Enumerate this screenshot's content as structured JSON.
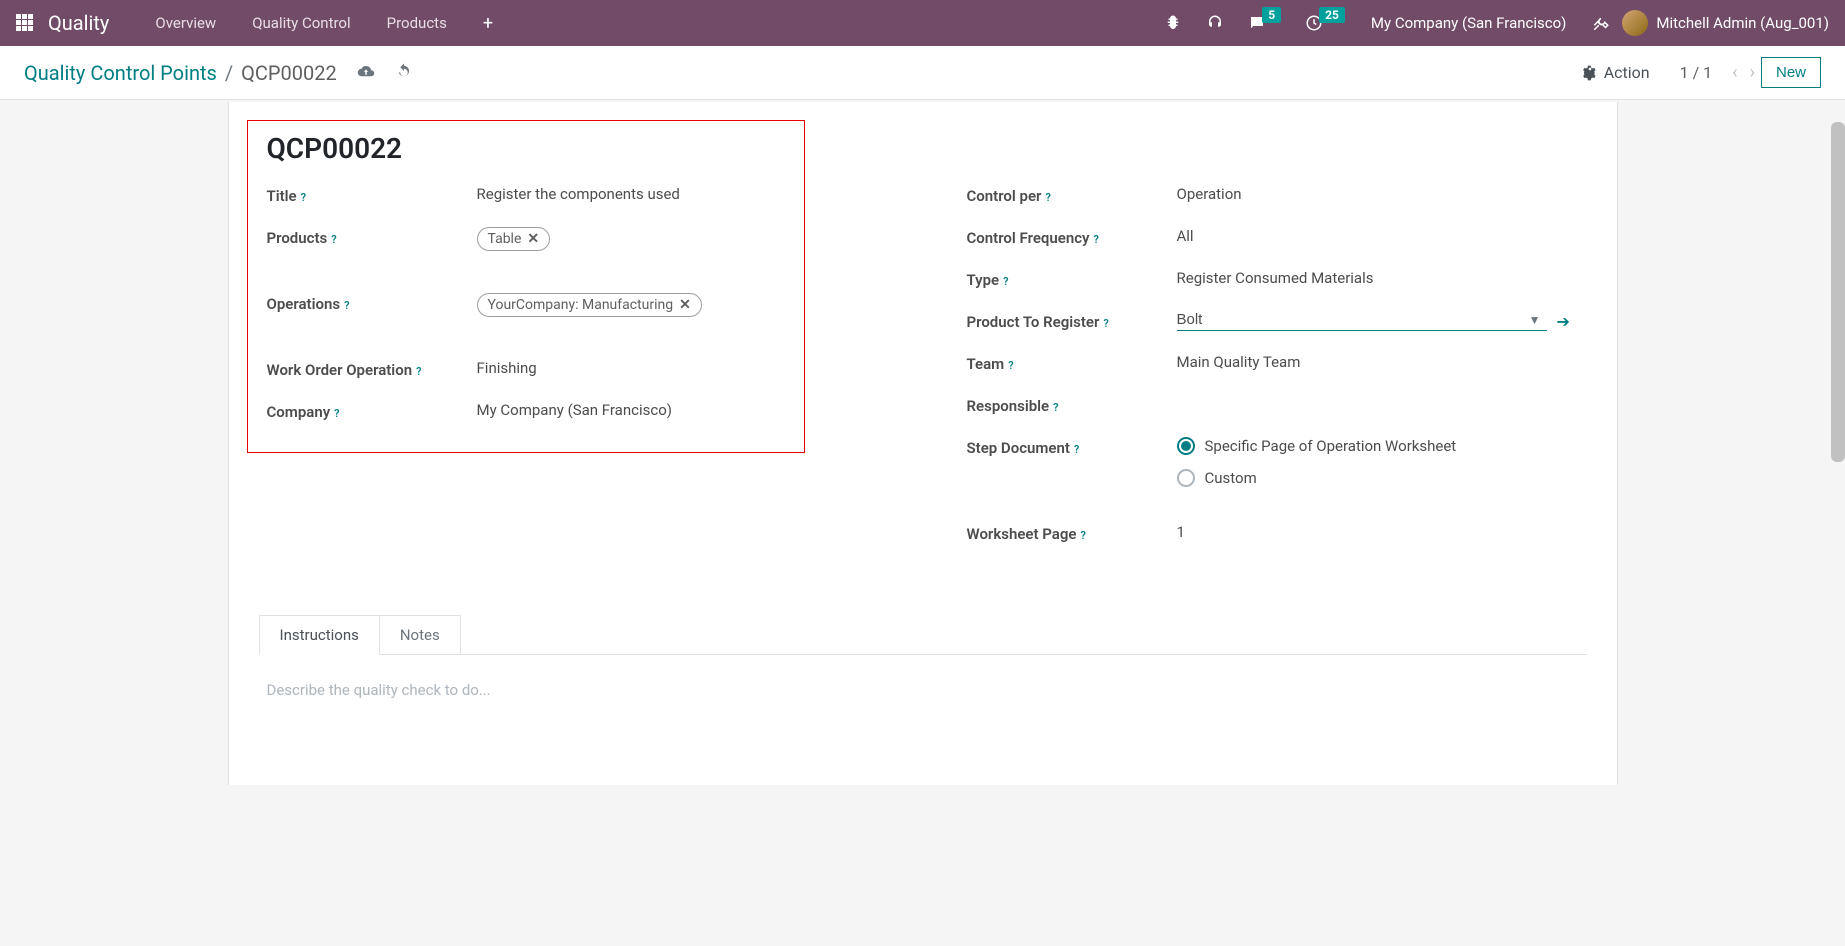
{
  "topbar": {
    "brand": "Quality",
    "nav": [
      "Overview",
      "Quality Control",
      "Products"
    ],
    "msg_badge": "5",
    "activity_badge": "25",
    "company": "My Company (San Francisco)",
    "user": "Mitchell Admin (Aug_001)"
  },
  "controlbar": {
    "breadcrumb_parent": "Quality Control Points",
    "breadcrumb_current": "QCP00022",
    "action_label": "Action",
    "pager": "1 / 1",
    "new_label": "New"
  },
  "form": {
    "title": "QCP00022",
    "left": {
      "title_label": "Title",
      "title_value": "Register the components used",
      "products_label": "Products",
      "products_tag": "Table",
      "operations_label": "Operations",
      "operations_tag": "YourCompany: Manufacturing",
      "wo_label": "Work Order Operation",
      "wo_value": "Finishing",
      "company_label": "Company",
      "company_value": "My Company (San Francisco)"
    },
    "right": {
      "controlper_label": "Control per",
      "controlper_value": "Operation",
      "freq_label": "Control Frequency",
      "freq_value": "All",
      "type_label": "Type",
      "type_value": "Register Consumed Materials",
      "ptr_label": "Product To Register",
      "ptr_value": "Bolt",
      "team_label": "Team",
      "team_value": "Main Quality Team",
      "responsible_label": "Responsible",
      "responsible_value": "",
      "stepdoc_label": "Step Document",
      "stepdoc_opt1": "Specific Page of Operation Worksheet",
      "stepdoc_opt2": "Custom",
      "wspage_label": "Worksheet Page",
      "wspage_value": "1"
    }
  },
  "tabs": {
    "instructions": "Instructions",
    "notes": "Notes",
    "placeholder": "Describe the quality check to do..."
  }
}
